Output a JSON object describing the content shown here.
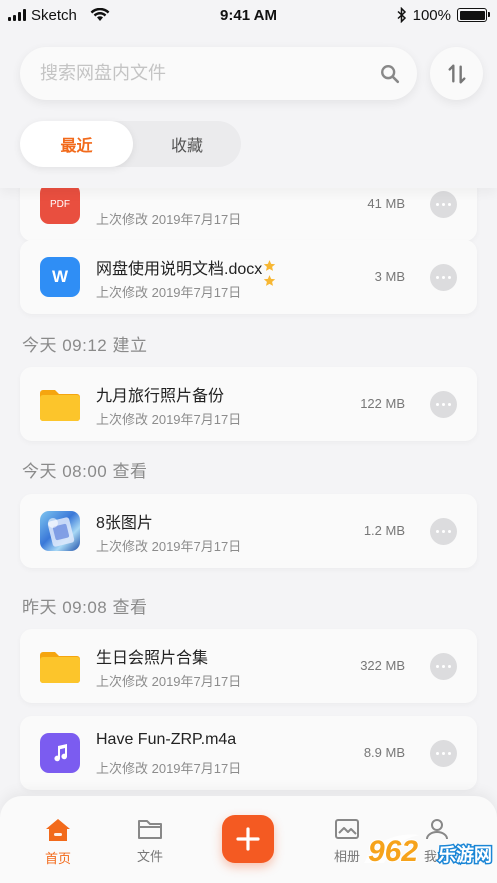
{
  "status_bar": {
    "carrier": "Sketch",
    "time": "9:41 AM",
    "battery": "100%",
    "battery_level": 1.0
  },
  "search": {
    "placeholder": "搜索网盘内文件",
    "value": ""
  },
  "tabs": [
    {
      "label": "最近",
      "active": true
    },
    {
      "label": "收藏",
      "active": false
    }
  ],
  "files": [
    {
      "name": "",
      "meta": "上次修改 2019年7月17日",
      "size": "41 MB",
      "icon": "pdf-icon",
      "icon_label": "PDF",
      "color": "#e94f3f"
    },
    {
      "name": "网盘使用说明文档.docx",
      "meta": "上次修改 2019年7月17日",
      "size": "3 MB",
      "icon": "word-icon",
      "icon_label": "W",
      "color": "#2f8ef5",
      "starred": true
    },
    {
      "name": "九月旅行照片备份",
      "meta": "上次修改 2019年7月17日",
      "size": "122 MB",
      "icon": "folder-icon",
      "color": "#fcbb1e"
    },
    {
      "name": "8张图片",
      "meta": "上次修改 2019年7月17日",
      "size": "1.2 MB",
      "icon": "image-thumbnail-icon",
      "color": "#3a9be0"
    },
    {
      "name": "生日会照片合集",
      "meta": "上次修改 2019年7月17日",
      "size": "322 MB",
      "icon": "folder-icon",
      "color": "#fcbb1e"
    },
    {
      "name": "Have Fun-ZRP.m4a",
      "meta": "上次修改 2019年7月17日",
      "size": "8.9 MB",
      "icon": "music-icon",
      "color": "#7b5cf0"
    }
  ],
  "sections": [
    {
      "label": "今天 09:12 建立"
    },
    {
      "label": "今天 08:00 查看"
    },
    {
      "label": "昨天 09:08 查看"
    }
  ],
  "bottom_nav": {
    "items": [
      {
        "label": "首页",
        "icon": "home-icon",
        "active": true
      },
      {
        "label": "文件",
        "icon": "folder-outline-icon",
        "active": false
      },
      {
        "label": "相册",
        "icon": "photo-icon",
        "active": false
      },
      {
        "label": "我的",
        "icon": "user-icon",
        "active": false
      }
    ],
    "add_icon": "plus-icon"
  },
  "watermark": {
    "text": "962",
    "subtext": "乐游网"
  },
  "colors": {
    "accent": "#f26a1b",
    "add_button": "#f45a22",
    "star": "#f7b733",
    "background": "#f4f4f6"
  }
}
